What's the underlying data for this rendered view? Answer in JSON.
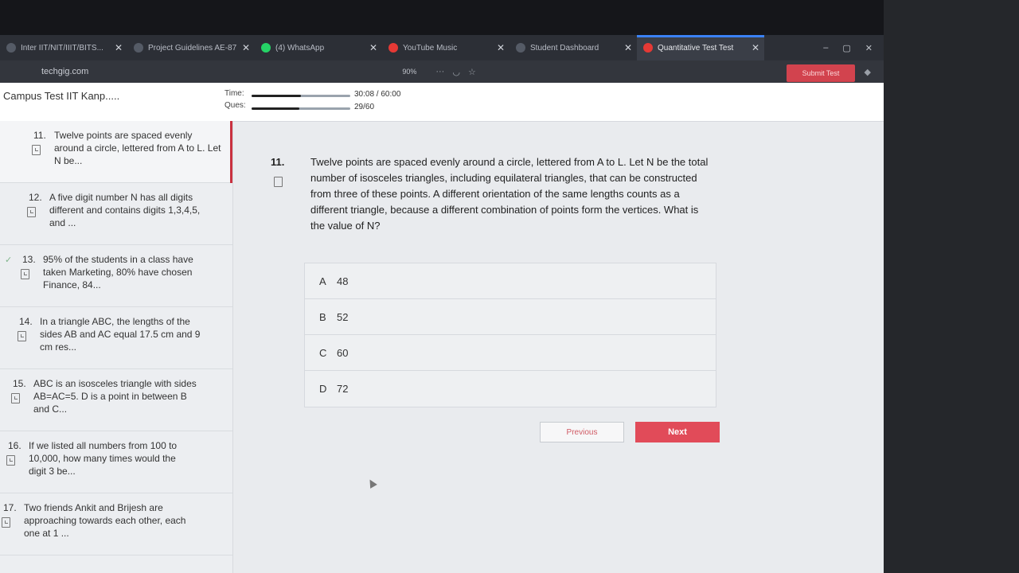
{
  "browser": {
    "tabs": [
      {
        "label": "Inter IIT/NIT/IIIT/BITS...",
        "fav_color": "#555b66",
        "active": false
      },
      {
        "label": "Project Guidelines AE-87",
        "fav_color": "#555b66",
        "active": false
      },
      {
        "label": "(4) WhatsApp",
        "fav_color": "#25d366",
        "active": false
      },
      {
        "label": "YouTube Music",
        "fav_color": "#e53935",
        "active": false
      },
      {
        "label": "Student Dashboard",
        "fav_color": "#555b66",
        "active": false
      },
      {
        "label": "Quantitative Test Test",
        "fav_color": "#e53935",
        "active": true
      }
    ],
    "url": "techgig.com",
    "zoom": "90%"
  },
  "header": {
    "title": "Campus Test IIT Kanp.....",
    "time_label": "Time:",
    "time_value": "30:08 / 60:00",
    "time_fraction": 0.502,
    "ques_label": "Ques:",
    "ques_value": "29/60",
    "ques_fraction": 0.483,
    "submit_label": "Submit Test"
  },
  "sidebar": {
    "items": [
      {
        "num": "11.",
        "text": "Twelve points are spaced evenly around a circle, lettered from A to L. Let N be...",
        "current": true,
        "answered": false
      },
      {
        "num": "12.",
        "text": "A five digit number N has all digits different and contains digits 1,3,4,5, and ...",
        "current": false,
        "answered": false
      },
      {
        "num": "13.",
        "text": "95% of the students in a class have taken Marketing, 80% have chosen Finance, 84...",
        "current": false,
        "answered": true
      },
      {
        "num": "14.",
        "text": "In a triangle ABC, the lengths of the sides AB and AC equal 17.5 cm and 9 cm res...",
        "current": false,
        "answered": false
      },
      {
        "num": "15.",
        "text": "ABC is an isosceles triangle with sides AB=AC=5. D is a point in between B and C...",
        "current": false,
        "answered": false
      },
      {
        "num": "16.",
        "text": "If we listed all numbers from 100 to 10,000, how many times would the digit 3 be...",
        "current": false,
        "answered": false
      },
      {
        "num": "17.",
        "text": "Two friends Ankit and Brijesh are approaching towards each other, each one at 1 ...",
        "current": false,
        "answered": false
      }
    ]
  },
  "question": {
    "number": "11.",
    "text": "Twelve points are spaced evenly around a circle, lettered from A to L. Let N be the total number of isosceles triangles, including equilateral triangles, that can be constructed from three of these points. A different orientation of the same lengths counts as a different triangle, because a different combination of points form the vertices. What is the value of N?",
    "options": [
      {
        "letter": "A",
        "value": "48"
      },
      {
        "letter": "B",
        "value": "52"
      },
      {
        "letter": "C",
        "value": "60"
      },
      {
        "letter": "D",
        "value": "72"
      }
    ]
  },
  "nav": {
    "previous_label": "Previous",
    "next_label": "Next"
  }
}
